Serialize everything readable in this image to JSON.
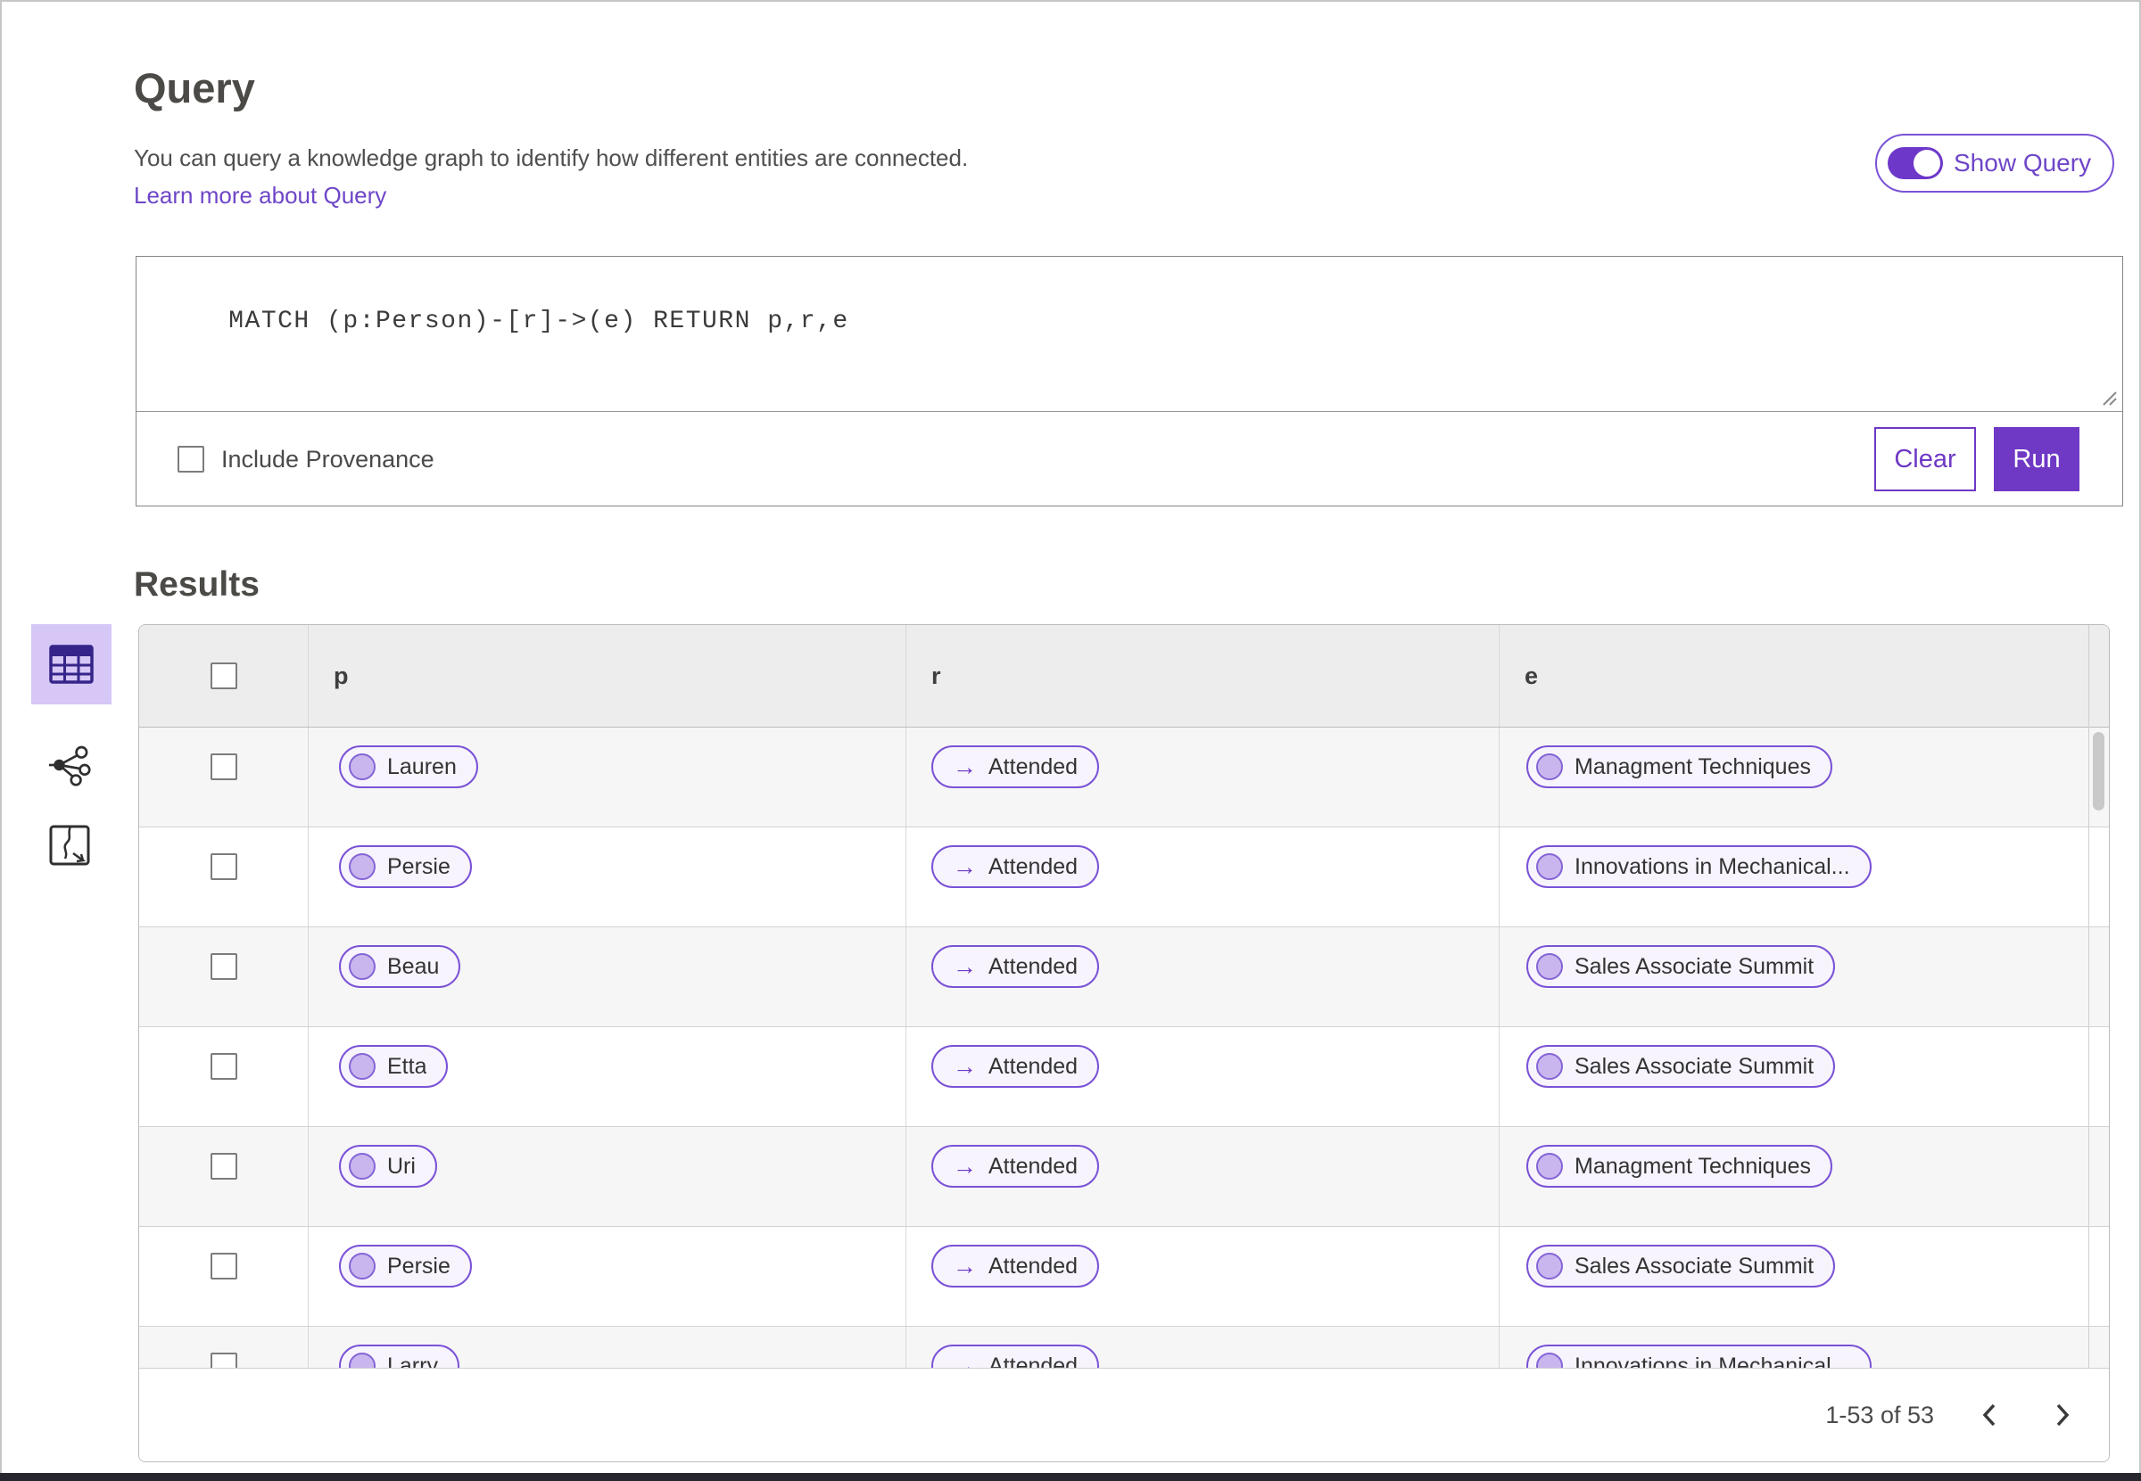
{
  "page": {
    "title": "Query",
    "description": "You can query a knowledge graph to identify how different entities are connected.",
    "learn_more": "Learn more about Query",
    "show_query_label": "Show Query",
    "show_query_state": "on"
  },
  "query_editor": {
    "text": "MATCH (p:Person)-[r]->(e) RETURN p,r,e",
    "include_provenance_label": "Include Provenance",
    "include_provenance_checked": false,
    "clear_label": "Clear",
    "run_label": "Run"
  },
  "results": {
    "heading": "Results",
    "view_switcher": {
      "selected": "table",
      "options": [
        "table-view-icon",
        "graph-view-icon",
        "map-view-icon"
      ]
    },
    "columns": [
      "p",
      "r",
      "e"
    ],
    "rows": [
      {
        "p": "Lauren",
        "r": "Attended",
        "e": "Managment Techniques"
      },
      {
        "p": "Persie",
        "r": "Attended",
        "e": "Innovations in Mechanical..."
      },
      {
        "p": "Beau",
        "r": "Attended",
        "e": "Sales Associate Summit"
      },
      {
        "p": "Etta",
        "r": "Attended",
        "e": "Sales Associate Summit"
      },
      {
        "p": "Uri",
        "r": "Attended",
        "e": "Managment Techniques"
      },
      {
        "p": "Persie",
        "r": "Attended",
        "e": "Sales Associate Summit"
      },
      {
        "p": "Larry",
        "r": "Attended",
        "e": "Innovations in Mechanical..."
      }
    ],
    "relation_arrow": "→",
    "pagination": {
      "range_label": "1-53 of 53"
    }
  },
  "colors": {
    "accent_purple": "#6f38c5",
    "pill_border": "#7a52d6",
    "pill_background": "#f7f4fd",
    "node_fill": "#c9b6ee",
    "selected_tile_background": "#d6c7f6",
    "link_purple": "#6e46c8",
    "header_row_background": "#ededed",
    "stripe_row_background": "#f6f6f6"
  }
}
